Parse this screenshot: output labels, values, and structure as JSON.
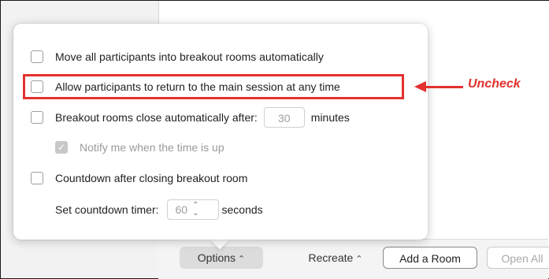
{
  "toolbar": {
    "options_label": "Options",
    "recreate_label": "Recreate",
    "add_room_label": "Add a Room",
    "open_all_label": "Open All"
  },
  "options_popup": {
    "move_all": {
      "label": "Move all participants into breakout rooms automatically",
      "checked": false
    },
    "allow_return": {
      "label": "Allow participants to return to the main session at any time",
      "checked": false
    },
    "auto_close": {
      "label": "Breakout rooms close automatically after:",
      "value": "30",
      "unit": "minutes",
      "checked": false
    },
    "notify": {
      "label": "Notify me when the time is up",
      "checked": true,
      "disabled": true
    },
    "countdown": {
      "label": "Countdown after closing breakout room",
      "checked": false
    },
    "countdown_timer": {
      "label": "Set countdown timer:",
      "value": "60",
      "unit": "seconds"
    }
  },
  "annotation": {
    "text": "Uncheck",
    "color": "#e3312f"
  },
  "colors": {
    "accent_red": "#e3312f",
    "popup_bg": "#ffffff",
    "toolbar_bg": "#f4f4f4"
  },
  "icons": {
    "chevron": "chevron-up-icon",
    "checkbox": "checkbox-icon",
    "stepper": "stepper-icon"
  }
}
